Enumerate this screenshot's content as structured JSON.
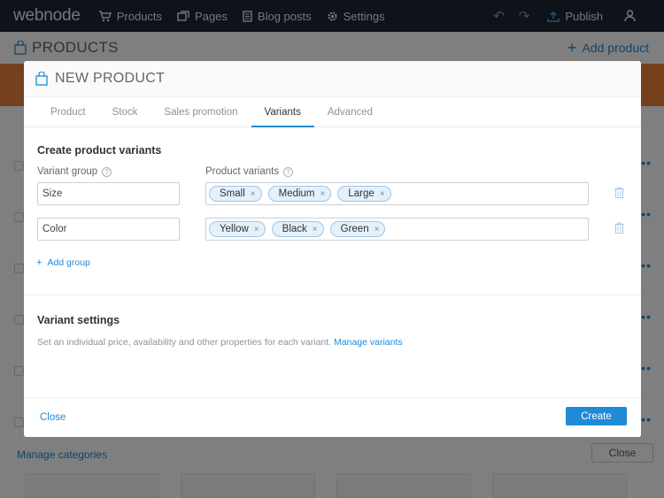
{
  "app": {
    "logo": "webnode",
    "nav": [
      {
        "label": "Products",
        "icon": "cart-icon"
      },
      {
        "label": "Pages",
        "icon": "pages-icon"
      },
      {
        "label": "Blog posts",
        "icon": "document-icon"
      },
      {
        "label": "Settings",
        "icon": "gear-icon"
      }
    ],
    "undo_icon": "↶",
    "redo_icon": "↷",
    "publish_label": "Publish",
    "page_title": "PRODUCTS",
    "add_product_label": "Add product",
    "manage_categories_label": "Manage categories",
    "close_label": "Close"
  },
  "modal": {
    "title": "NEW PRODUCT",
    "tabs": [
      {
        "label": "Product",
        "active": false
      },
      {
        "label": "Stock",
        "active": false
      },
      {
        "label": "Sales promotion",
        "active": false
      },
      {
        "label": "Variants",
        "active": true
      },
      {
        "label": "Advanced",
        "active": false
      }
    ],
    "create_variants_title": "Create product variants",
    "variant_group_label": "Variant group",
    "product_variants_label": "Product variants",
    "groups": [
      {
        "name": "Size",
        "variants": [
          "Small",
          "Medium",
          "Large"
        ]
      },
      {
        "name": "Color",
        "variants": [
          "Yellow",
          "Black",
          "Green"
        ]
      }
    ],
    "add_group_label": "Add group",
    "variant_settings_title": "Variant settings",
    "variant_settings_desc": "Set an individual price, availability and other properties for each variant.",
    "manage_variants_label": "Manage variants",
    "close_label": "Close",
    "create_label": "Create",
    "help_glyph": "?",
    "remove_glyph": "×",
    "plus_glyph": "+"
  },
  "colors": {
    "accent": "#1f8ad6",
    "topbar": "#1d2632",
    "banner": "#e8813b"
  }
}
